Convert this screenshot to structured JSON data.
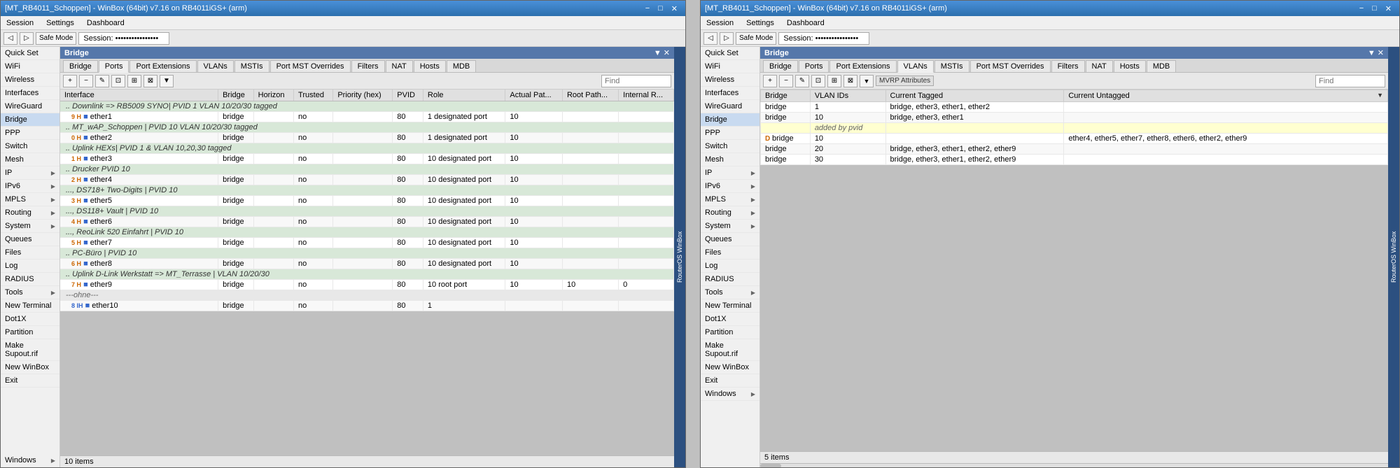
{
  "leftWindow": {
    "titleBar": {
      "title": "[MT_RB4011_Schoppen] - WinBox (64bit) v7.16 on RB4011iGS+ (arm)",
      "controls": [
        "minimize",
        "maximize",
        "close"
      ]
    },
    "menuBar": [
      "Session",
      "Settings",
      "Dashboard"
    ],
    "toolbar": {
      "safeMode": "Safe Mode",
      "sessionLabel": "Session: ••••••••••••••••"
    },
    "bridgePanel": {
      "title": "Bridge",
      "tabs": [
        "Bridge",
        "Ports",
        "Port Extensions",
        "VLANs",
        "MSTIs",
        "Port MST Overrides",
        "Filters",
        "NAT",
        "Hosts",
        "MDB"
      ],
      "activeTab": "Ports",
      "toolbarButtons": [
        "+",
        "−",
        "✎",
        "⊡",
        "⊞",
        "⊠",
        "▼"
      ],
      "searchPlaceholder": "Find",
      "columns": [
        "Interface",
        "Bridge",
        "Horizon",
        "Trusted",
        "Priority (hex)",
        "PVID",
        "Role",
        "Actual Pat...",
        "Root Path...",
        "Internal R..."
      ],
      "rows": [
        {
          "indent": 1,
          "type": "header",
          "interface": "Downlink => RB5009 SYNO| PVID 1 VLAN 10/20/30 tagged",
          "bridge": "",
          "horizon": "",
          "trusted": "",
          "priority": "",
          "pvid": "",
          "role": "",
          "ap": "",
          "rp": "",
          "ir": ""
        },
        {
          "indent": 2,
          "type": "item",
          "num": "9 H",
          "interface": "ether1",
          "bridge": "bridge",
          "horizon": "",
          "trusted": "no",
          "priority": "",
          "pvid": "80",
          "role": "1 designated port",
          "ap": "10",
          "rp": "",
          "ir": ""
        },
        {
          "indent": 1,
          "type": "header",
          "interface": "MT_wAP_Schoppen | PVID 10 VLAN 10/20/30 tagged",
          "bridge": "",
          "horizon": "",
          "trusted": "",
          "priority": "",
          "pvid": "",
          "role": "",
          "ap": "",
          "rp": "",
          "ir": ""
        },
        {
          "indent": 2,
          "type": "item",
          "num": "0 H",
          "interface": "ether2",
          "bridge": "bridge",
          "horizon": "",
          "trusted": "no",
          "priority": "",
          "pvid": "80",
          "role": "1 designated port",
          "ap": "10",
          "rp": "",
          "ir": ""
        },
        {
          "indent": 1,
          "type": "header",
          "interface": "Uplink HEXs| PVID 1 & VLAN 10,20,30 tagged",
          "bridge": "",
          "horizon": "",
          "trusted": "",
          "priority": "",
          "pvid": "",
          "role": "",
          "ap": "",
          "rp": "",
          "ir": ""
        },
        {
          "indent": 2,
          "type": "item",
          "num": "1 H",
          "interface": "ether3",
          "bridge": "bridge",
          "horizon": "",
          "trusted": "no",
          "priority": "",
          "pvid": "80",
          "role": "10 designated port",
          "ap": "10",
          "rp": "",
          "ir": ""
        },
        {
          "indent": 1,
          "type": "header",
          "interface": "Drucker PVID 10",
          "bridge": "",
          "horizon": "",
          "trusted": "",
          "priority": "",
          "pvid": "",
          "role": "",
          "ap": "",
          "rp": "",
          "ir": ""
        },
        {
          "indent": 2,
          "type": "item",
          "num": "2 H",
          "interface": "ether4",
          "bridge": "bridge",
          "horizon": "",
          "trusted": "no",
          "priority": "",
          "pvid": "80",
          "role": "10 designated port",
          "ap": "10",
          "rp": "",
          "ir": ""
        },
        {
          "indent": 1,
          "type": "header",
          "interface": "DS718+ Two-Digits | PVID 10",
          "bridge": "",
          "horizon": "",
          "trusted": "",
          "priority": "",
          "pvid": "",
          "role": "",
          "ap": "",
          "rp": "",
          "ir": ""
        },
        {
          "indent": 2,
          "type": "item",
          "num": "3 H",
          "interface": "ether5",
          "bridge": "bridge",
          "horizon": "",
          "trusted": "no",
          "priority": "",
          "pvid": "80",
          "role": "10 designated port",
          "ap": "10",
          "rp": "",
          "ir": ""
        },
        {
          "indent": 1,
          "type": "header",
          "interface": "DS118+ Vault | PVID 10",
          "bridge": "",
          "horizon": "",
          "trusted": "",
          "priority": "",
          "pvid": "",
          "role": "",
          "ap": "",
          "rp": "",
          "ir": ""
        },
        {
          "indent": 2,
          "type": "item",
          "num": "4 H",
          "interface": "ether6",
          "bridge": "bridge",
          "horizon": "",
          "trusted": "no",
          "priority": "",
          "pvid": "80",
          "role": "10 designated port",
          "ap": "10",
          "rp": "",
          "ir": ""
        },
        {
          "indent": 1,
          "type": "header",
          "interface": "ReoLink 520 Einfahrt | PVID 10",
          "bridge": "",
          "horizon": "",
          "trusted": "",
          "priority": "",
          "pvid": "",
          "role": "",
          "ap": "",
          "rp": "",
          "ir": ""
        },
        {
          "indent": 2,
          "type": "item",
          "num": "5 H",
          "interface": "ether7",
          "bridge": "bridge",
          "horizon": "",
          "trusted": "no",
          "priority": "",
          "pvid": "80",
          "role": "10 designated port",
          "ap": "10",
          "rp": "",
          "ir": ""
        },
        {
          "indent": 1,
          "type": "header",
          "interface": "PC-Büro | PVID 10",
          "bridge": "",
          "horizon": "",
          "trusted": "",
          "priority": "",
          "pvid": "",
          "role": "",
          "ap": "",
          "rp": "",
          "ir": ""
        },
        {
          "indent": 2,
          "type": "item",
          "num": "6 H",
          "interface": "ether8",
          "bridge": "bridge",
          "horizon": "",
          "trusted": "no",
          "priority": "",
          "pvid": "80",
          "role": "10 designated port",
          "ap": "10",
          "rp": "",
          "ir": ""
        },
        {
          "indent": 1,
          "type": "header",
          "interface": "Uplink D-Link Werkstatt => MT_Terrasse | VLAN 10/20/30",
          "bridge": "",
          "horizon": "",
          "trusted": "",
          "priority": "",
          "pvid": "",
          "role": "",
          "ap": "",
          "rp": "",
          "ir": ""
        },
        {
          "indent": 2,
          "type": "item",
          "num": "7 H",
          "interface": "ether9",
          "bridge": "bridge",
          "horizon": "",
          "trusted": "no",
          "priority": "",
          "pvid": "80",
          "role": "10 root port",
          "ap": "10",
          "rp": "10",
          "ir": "0"
        },
        {
          "indent": 1,
          "type": "separator",
          "interface": "---ohne---",
          "bridge": "",
          "horizon": "",
          "trusted": "",
          "priority": "",
          "pvid": "",
          "role": "",
          "ap": "",
          "rp": "",
          "ir": ""
        },
        {
          "indent": 2,
          "type": "item",
          "num": "8 IH",
          "interface": "ether10",
          "bridge": "bridge",
          "horizon": "",
          "trusted": "no",
          "priority": "",
          "pvid": "80",
          "role": "1",
          "ap": "",
          "rp": "",
          "ir": ""
        }
      ],
      "statusBar": "10 items"
    },
    "sidebar": {
      "items": [
        {
          "label": "Quick Set",
          "icon": "quickset"
        },
        {
          "label": "WiFi",
          "icon": "wifi"
        },
        {
          "label": "Wireless",
          "icon": "wireless"
        },
        {
          "label": "Interfaces",
          "icon": "interfaces"
        },
        {
          "label": "WireGuard",
          "icon": "wireguard"
        },
        {
          "label": "Bridge",
          "icon": "bridge",
          "active": true
        },
        {
          "label": "PPP",
          "icon": "ppp"
        },
        {
          "label": "Switch",
          "icon": "switch"
        },
        {
          "label": "Mesh",
          "icon": "mesh"
        },
        {
          "label": "IP",
          "icon": "ip"
        },
        {
          "label": "IPv6",
          "icon": "ipv6"
        },
        {
          "label": "MPLS",
          "icon": "mpls"
        },
        {
          "label": "Routing",
          "icon": "routing"
        },
        {
          "label": "System",
          "icon": "system"
        },
        {
          "label": "Queues",
          "icon": "queues"
        },
        {
          "label": "Files",
          "icon": "files"
        },
        {
          "label": "Log",
          "icon": "log"
        },
        {
          "label": "RADIUS",
          "icon": "radius"
        },
        {
          "label": "Tools",
          "icon": "tools"
        },
        {
          "label": "New Terminal",
          "icon": "terminal"
        },
        {
          "label": "Dot1X",
          "icon": "dot1x"
        },
        {
          "label": "Partition",
          "icon": "partition"
        },
        {
          "label": "Make Supout.rif",
          "icon": "supout"
        },
        {
          "label": "New WinBox",
          "icon": "winbox"
        },
        {
          "label": "Exit",
          "icon": "exit"
        },
        {
          "label": "Windows",
          "icon": "windows"
        }
      ]
    }
  },
  "rightWindow": {
    "titleBar": {
      "title": "[MT_RB4011_Schoppen] - WinBox (64bit) v7.16 on RB4011iGS+ (arm)"
    },
    "menuBar": [
      "Session",
      "Settings",
      "Dashboard"
    ],
    "toolbar": {
      "safeMode": "Safe Mode",
      "sessionLabel": "Session: ••••••••••••••••"
    },
    "bridgePanel": {
      "title": "Bridge",
      "tabs": [
        "Bridge",
        "Ports",
        "Port Extensions",
        "VLANs",
        "MSTIs",
        "Port MST Overrides",
        "Filters",
        "NAT",
        "Hosts",
        "MDB"
      ],
      "activeTab": "VLANs",
      "mrpButton": "MVRP Attributes",
      "searchPlaceholder": "Find",
      "columns": [
        "Bridge",
        "VLAN IDs",
        "Current Tagged",
        "Current Untagged"
      ],
      "rows": [
        {
          "bridge": "bridge",
          "vlanIds": "1",
          "tagged": "bridge, ether3, ether1, ether2",
          "untagged": ""
        },
        {
          "bridge": "bridge",
          "vlanIds": "10",
          "tagged": "bridge, ether3, ether1",
          "untagged": ""
        },
        {
          "bridge": "",
          "vlanIds": "added by pvid",
          "tagged": "",
          "untagged": ""
        },
        {
          "bridge": "D bridge",
          "vlanIds": "10",
          "tagged": "",
          "untagged": "ether4, ether5, ether7, ether8, ether6, ether2, ether9"
        },
        {
          "bridge": "bridge",
          "vlanIds": "20",
          "tagged": "bridge, ether3, ether1, ether2, ether9",
          "untagged": ""
        },
        {
          "bridge": "bridge",
          "vlanIds": "30",
          "tagged": "bridge, ether3, ether1, ether2, ether9",
          "untagged": ""
        }
      ],
      "statusBar": "5 items"
    },
    "sidebar": {
      "items": [
        {
          "label": "Quick Set",
          "icon": "quickset"
        },
        {
          "label": "WiFi",
          "icon": "wifi"
        },
        {
          "label": "Wireless",
          "icon": "wireless"
        },
        {
          "label": "Interfaces",
          "icon": "interfaces"
        },
        {
          "label": "WireGuard",
          "icon": "wireguard"
        },
        {
          "label": "Bridge",
          "icon": "bridge",
          "active": true
        },
        {
          "label": "PPP",
          "icon": "ppp"
        },
        {
          "label": "Switch",
          "icon": "switch"
        },
        {
          "label": "Mesh",
          "icon": "mesh"
        },
        {
          "label": "IP",
          "icon": "ip"
        },
        {
          "label": "IPv6",
          "icon": "ipv6"
        },
        {
          "label": "MPLS",
          "icon": "mpls"
        },
        {
          "label": "Routing",
          "icon": "routing"
        },
        {
          "label": "System",
          "icon": "system"
        },
        {
          "label": "Queues",
          "icon": "queues"
        },
        {
          "label": "Files",
          "icon": "files"
        },
        {
          "label": "Log",
          "icon": "log"
        },
        {
          "label": "RADIUS",
          "icon": "radius"
        },
        {
          "label": "Tools",
          "icon": "tools"
        },
        {
          "label": "New Terminal",
          "icon": "terminal"
        },
        {
          "label": "Dot1X",
          "icon": "dot1x"
        },
        {
          "label": "Partition",
          "icon": "partition"
        },
        {
          "label": "Make Supout.rif",
          "icon": "supout"
        },
        {
          "label": "New WinBox",
          "icon": "winbox"
        },
        {
          "label": "Exit",
          "icon": "exit"
        },
        {
          "label": "Windows",
          "icon": "windows"
        }
      ]
    }
  }
}
